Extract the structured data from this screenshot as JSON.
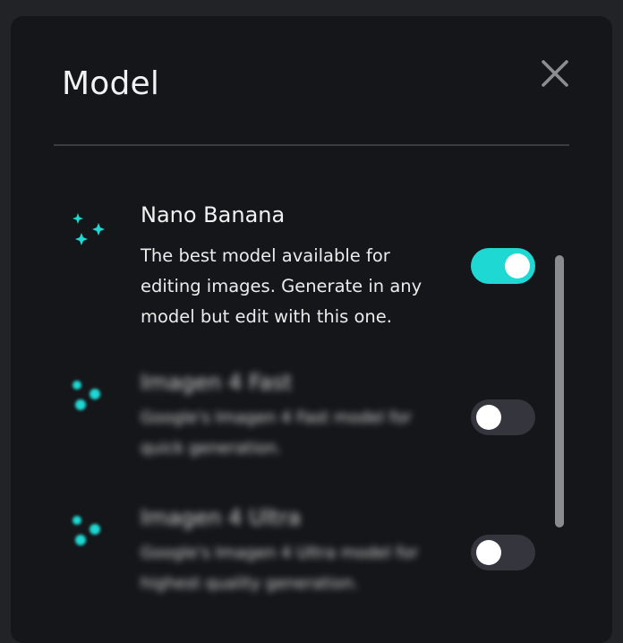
{
  "dialog": {
    "title": "Model",
    "close_icon": "close-icon"
  },
  "models": [
    {
      "name": "Nano Banana",
      "description": "The best model available for editing images. Generate in any model but edit with this one.",
      "enabled": true,
      "icon": "sparkle-icon"
    },
    {
      "name": "Imagen 4 Fast",
      "description": "Google's Imagen 4 Fast model for quick generation.",
      "enabled": false,
      "icon": "sparkle-icon"
    },
    {
      "name": "Imagen 4 Ultra",
      "description": "Google's Imagen 4 Ultra model for highest quality generation.",
      "enabled": false,
      "icon": "sparkle-icon"
    }
  ],
  "colors": {
    "accent": "#1ed8d3",
    "panel": "#151619",
    "toggle_off": "#34353d"
  }
}
